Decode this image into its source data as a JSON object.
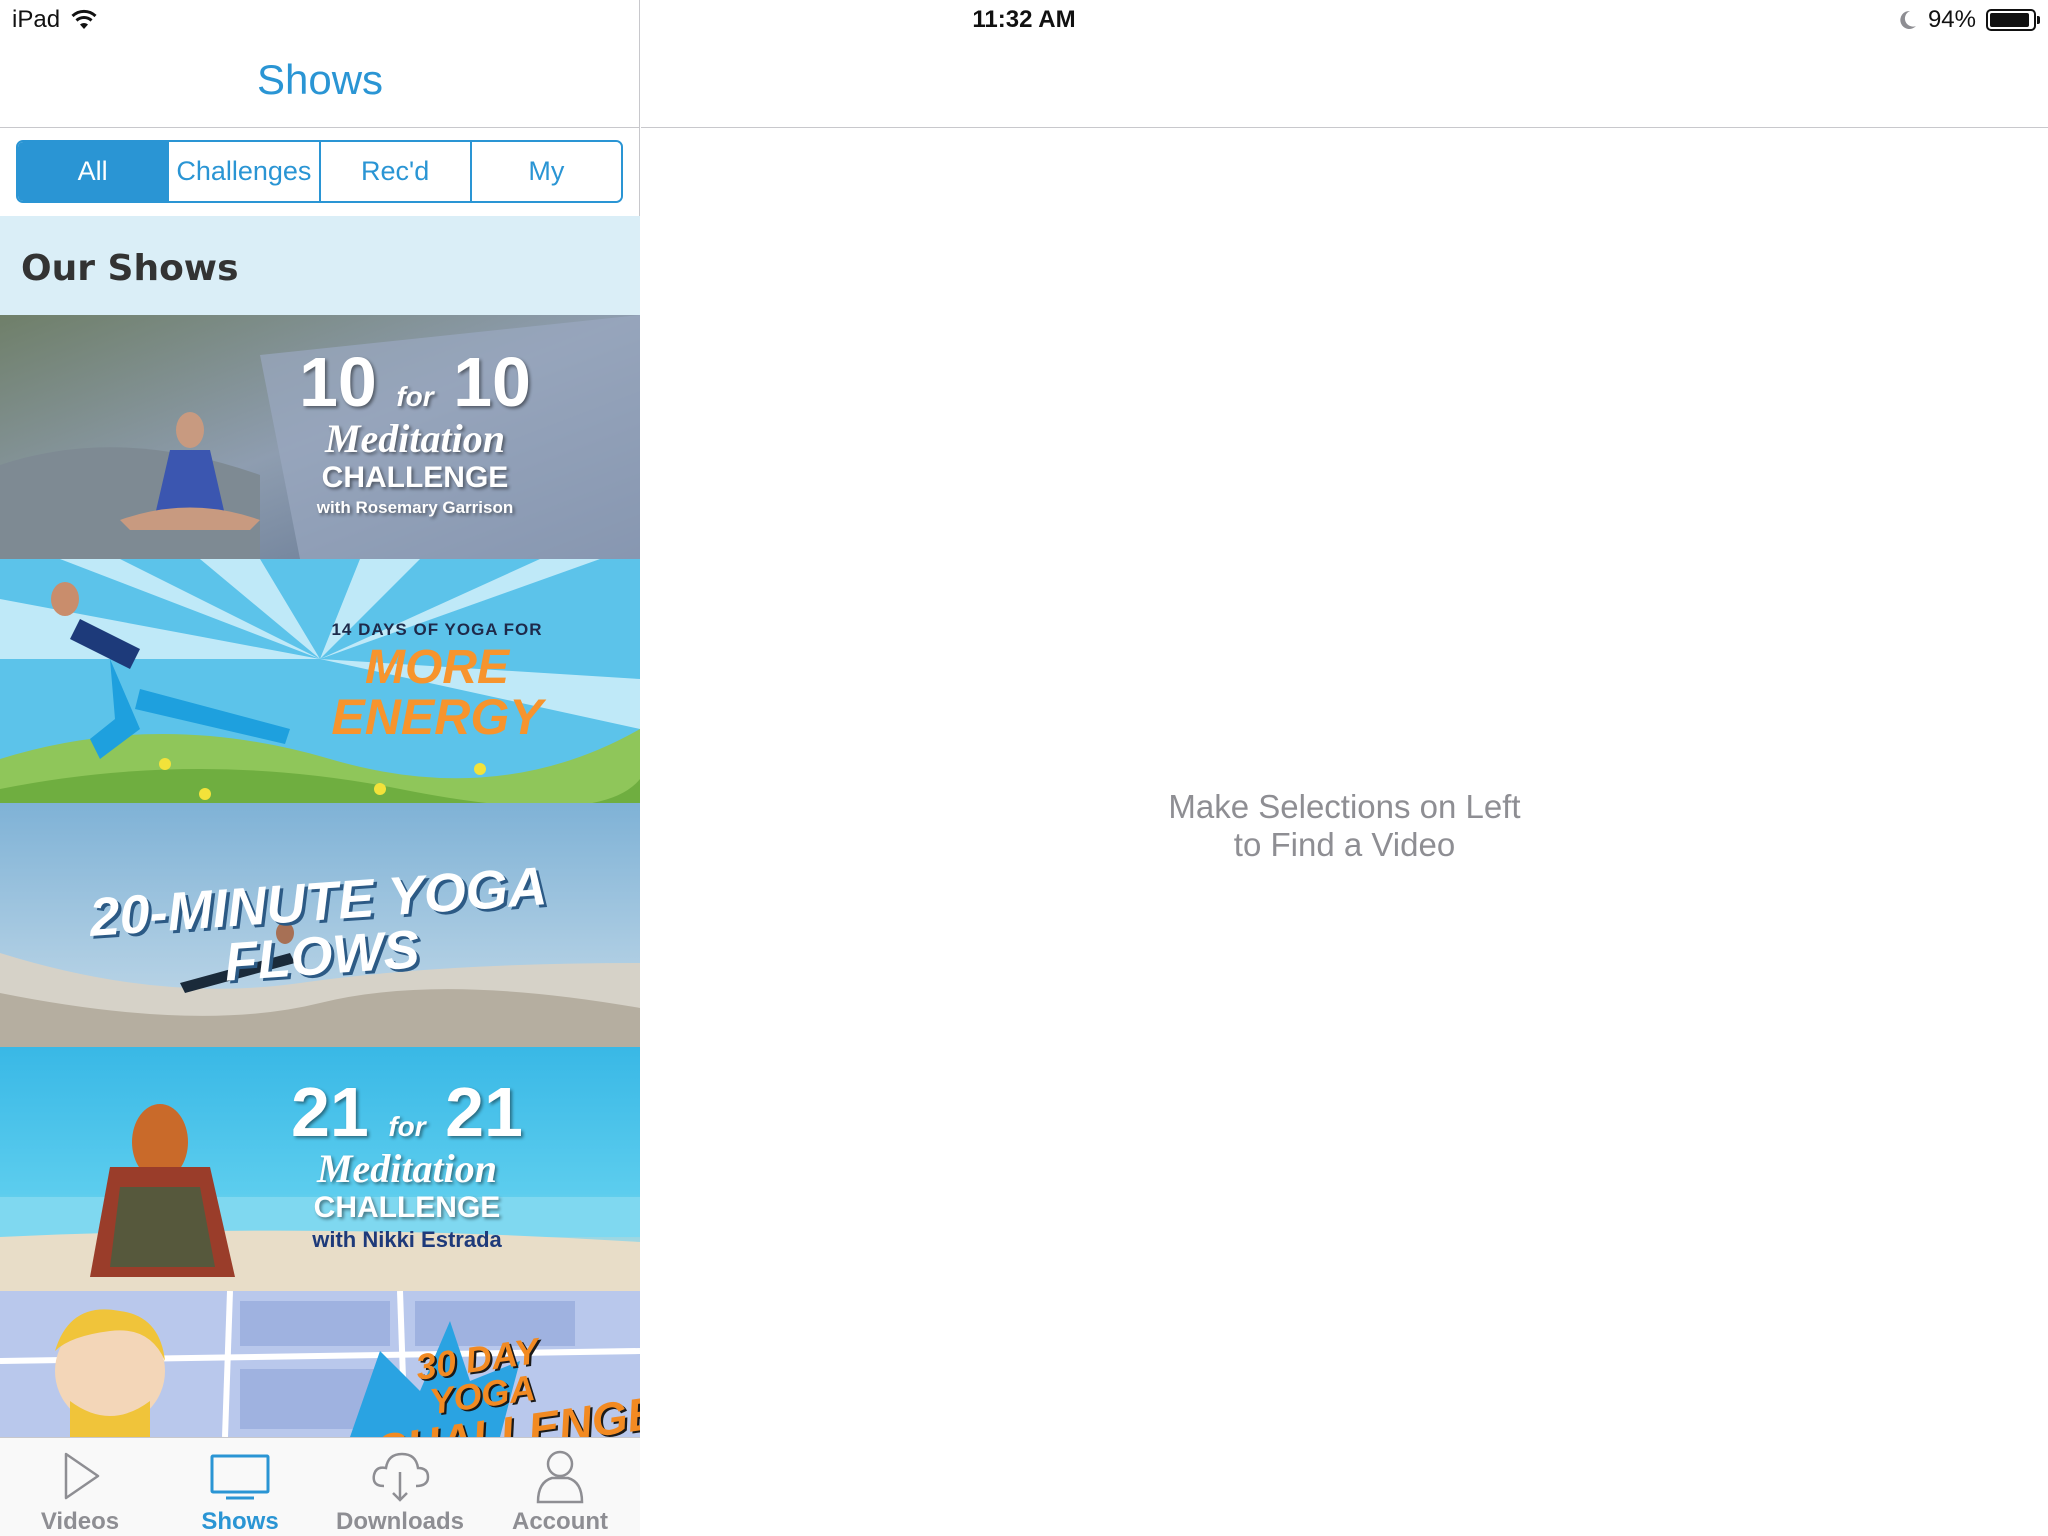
{
  "status_bar": {
    "device": "iPad",
    "time": "11:32 AM",
    "battery": "94%",
    "battery_level": 0.94
  },
  "nav": {
    "title": "Shows"
  },
  "segments": [
    {
      "label": "All",
      "selected": true
    },
    {
      "label": "Challenges",
      "selected": false
    },
    {
      "label": "Rec'd",
      "selected": false
    },
    {
      "label": "My",
      "selected": false
    }
  ],
  "section": {
    "title": "Our Shows"
  },
  "shows": [
    {
      "line1": "10",
      "joiner": "for",
      "line1b": "10",
      "line2": "Meditation",
      "line3": "CHALLENGE",
      "byline": "with Rosemary Garrison"
    },
    {
      "line0": "14 DAYS OF YOGA FOR",
      "line1": "MORE",
      "line2": "ENERGY"
    },
    {
      "line1": "20-MINUTE YOGA FLOWS"
    },
    {
      "line1": "21",
      "joiner": "for",
      "line1b": "21",
      "line2": "Meditation",
      "line3": "CHALLENGE",
      "byline": "with Nikki Estrada"
    },
    {
      "line1": "30 DAY YOGA",
      "line2": "CHALLENGE"
    }
  ],
  "tabs": [
    {
      "label": "Videos",
      "icon": "play-icon",
      "active": false
    },
    {
      "label": "Shows",
      "icon": "tv-icon",
      "active": true
    },
    {
      "label": "Downloads",
      "icon": "cloud-download-icon",
      "active": false
    },
    {
      "label": "Account",
      "icon": "person-icon",
      "active": false
    }
  ],
  "detail": {
    "message_line1": "Make Selections on Left",
    "message_line2": "to Find a Video"
  },
  "colors": {
    "accent": "#2a95d4",
    "section_bg": "#daeef7",
    "inactive": "#8e8e93"
  }
}
